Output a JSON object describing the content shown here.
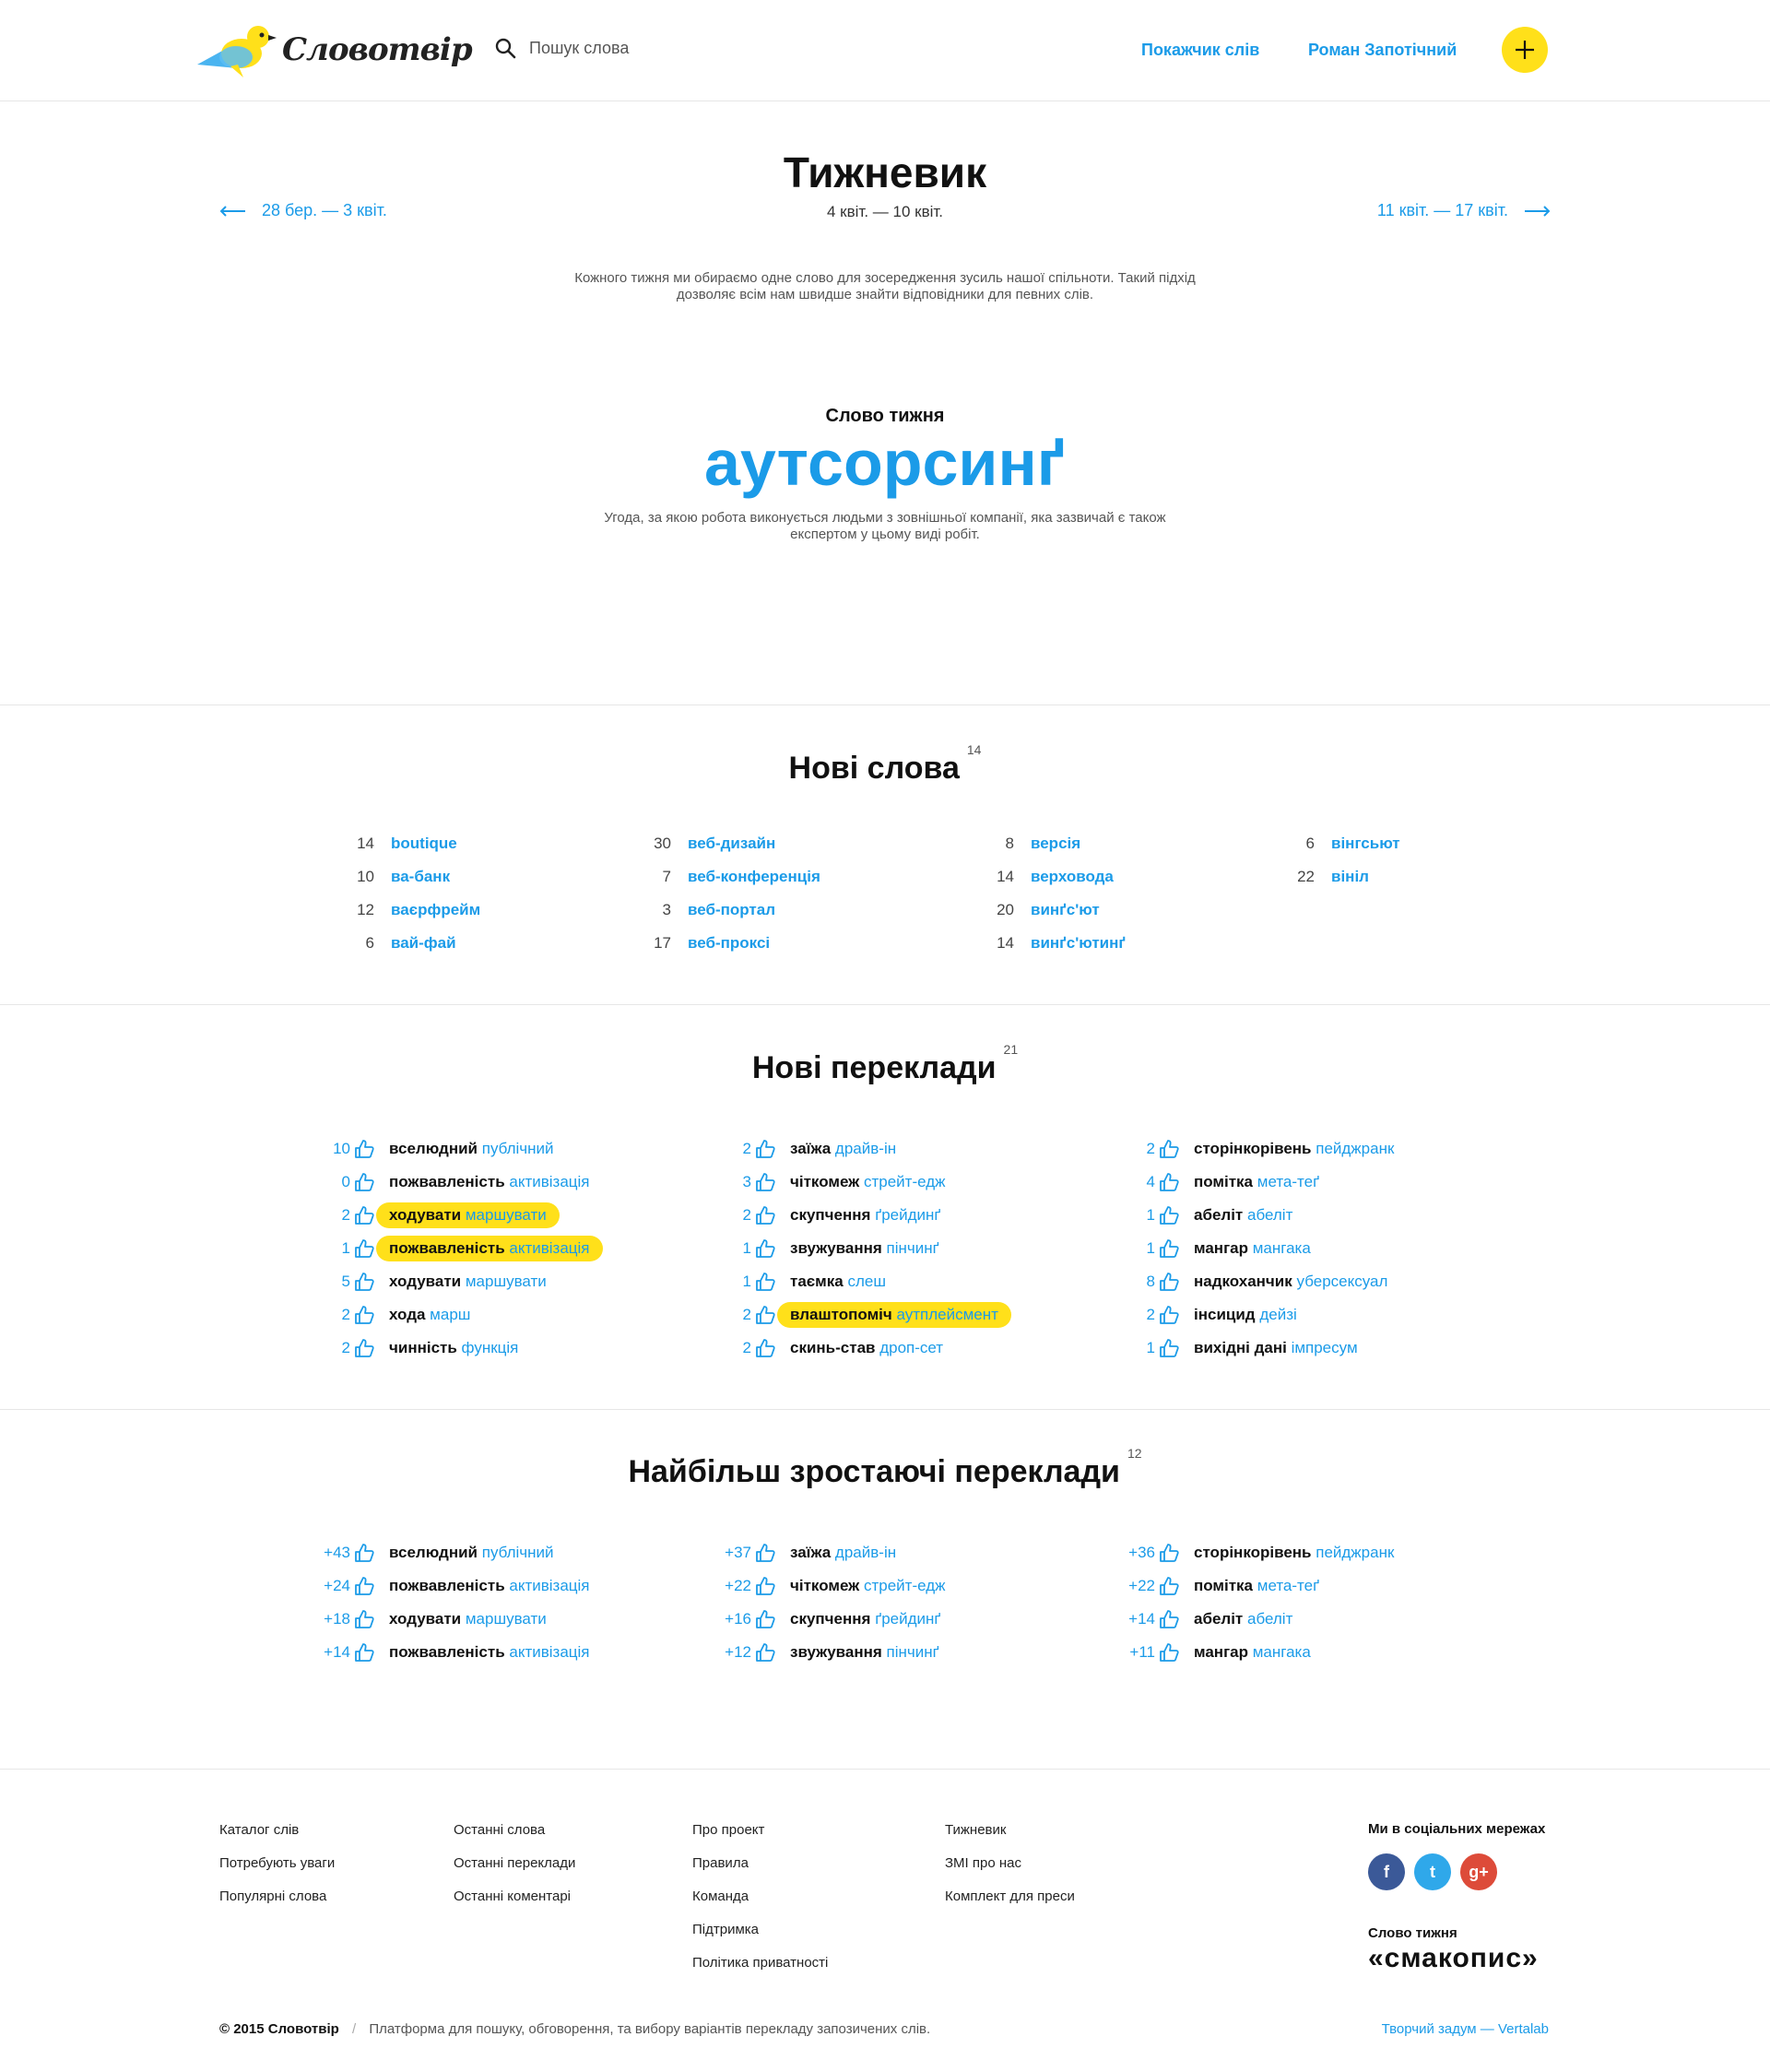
{
  "header": {
    "logo_text": "Словотвір",
    "search_placeholder": "Пошук слова",
    "nav": [
      "Покажчик слів",
      "Роман Запотічний"
    ]
  },
  "weekly": {
    "title": "Тижневик",
    "dates": "4 квіт. — 10 квіт.",
    "prev": "28 бер. — 3 квіт.",
    "next": "11 квіт. — 17 квіт.",
    "intro": "Кожного тижня ми обираємо одне слово для зосередження зусиль нашої спільноти. Такий підхід дозволяє всім нам швидше знайти відповідники для певних слів.",
    "word_label": "Слово тижня",
    "word": "аутсорсинґ",
    "definition": "Угода, за якою робота виконується людьми з зовнішньої компанії, яка зазвичай є також експертом у цьому виді робіт."
  },
  "new_words": {
    "title": "Нові слова",
    "count": "14",
    "columns": [
      [
        {
          "n": "14",
          "w": "boutique"
        },
        {
          "n": "10",
          "w": "ва-банк"
        },
        {
          "n": "12",
          "w": "ваєрфрейм"
        },
        {
          "n": "6",
          "w": "вай-фай"
        }
      ],
      [
        {
          "n": "30",
          "w": "веб-дизайн"
        },
        {
          "n": "7",
          "w": "веб-конференція"
        },
        {
          "n": "3",
          "w": "веб-портал"
        },
        {
          "n": "17",
          "w": "веб-проксі"
        }
      ],
      [
        {
          "n": "8",
          "w": "версія"
        },
        {
          "n": "14",
          "w": "верховода"
        },
        {
          "n": "20",
          "w": "винґс'ют"
        },
        {
          "n": "14",
          "w": "винґс'ютинґ"
        }
      ],
      [
        {
          "n": "6",
          "w": "вінгсьют"
        },
        {
          "n": "22",
          "w": "вініл"
        }
      ]
    ]
  },
  "new_translations": {
    "title": "Нові переклади",
    "count": "21",
    "columns": [
      [
        {
          "c": "10",
          "o": "вселюдний",
          "t": "публічний",
          "hl": false
        },
        {
          "c": "0",
          "o": "пожвавленість",
          "t": "активізація",
          "hl": false
        },
        {
          "c": "2",
          "o": "ходувати",
          "t": "маршувати",
          "hl": true
        },
        {
          "c": "1",
          "o": "пожвавленість",
          "t": "активізація",
          "hl": true
        },
        {
          "c": "5",
          "o": "ходувати",
          "t": "маршувати",
          "hl": false
        },
        {
          "c": "2",
          "o": "хода",
          "t": "марш",
          "hl": false
        },
        {
          "c": "2",
          "o": "чинність",
          "t": "функція",
          "hl": false
        }
      ],
      [
        {
          "c": "2",
          "o": "заїжа",
          "t": "драйв-ін",
          "hl": false
        },
        {
          "c": "3",
          "o": "чіткомеж",
          "t": "стрейт-едж",
          "hl": false
        },
        {
          "c": "2",
          "o": "скупчення",
          "t": "ґрейдинґ",
          "hl": false
        },
        {
          "c": "1",
          "o": "звужування",
          "t": "пінчинґ",
          "hl": false
        },
        {
          "c": "1",
          "o": "таємка",
          "t": "слеш",
          "hl": false
        },
        {
          "c": "2",
          "o": "влаштопоміч",
          "t": "аутплейсмент",
          "hl": true
        },
        {
          "c": "2",
          "o": "скинь-став",
          "t": "дроп-сет",
          "hl": false
        }
      ],
      [
        {
          "c": "2",
          "o": "сторінкорівень",
          "t": "пейджранк",
          "hl": false
        },
        {
          "c": "4",
          "o": "помітка",
          "t": "мета-теґ",
          "hl": false
        },
        {
          "c": "1",
          "o": "абеліт",
          "t": "абеліт",
          "hl": false
        },
        {
          "c": "1",
          "o": "мангар",
          "t": "мангака",
          "hl": false
        },
        {
          "c": "8",
          "o": "надкоханчик",
          "t": "уберсексуал",
          "hl": false
        },
        {
          "c": "2",
          "o": "інсицид",
          "t": "дейзі",
          "hl": false
        },
        {
          "c": "1",
          "o": "вихідні дані",
          "t": "імпресум",
          "hl": false
        }
      ]
    ]
  },
  "rising": {
    "title": "Найбільш зростаючі переклади",
    "count": "12",
    "columns": [
      [
        {
          "c": "+43",
          "o": "вселюдний",
          "t": "публічний"
        },
        {
          "c": "+24",
          "o": "пожвавленість",
          "t": "активізація"
        },
        {
          "c": "+18",
          "o": "ходувати",
          "t": "маршувати"
        },
        {
          "c": "+14",
          "o": "пожвавленість",
          "t": "активізація"
        }
      ],
      [
        {
          "c": "+37",
          "o": "заїжа",
          "t": "драйв-ін"
        },
        {
          "c": "+22",
          "o": "чіткомеж",
          "t": "стрейт-едж"
        },
        {
          "c": "+16",
          "o": "скупчення",
          "t": "ґрейдинґ"
        },
        {
          "c": "+12",
          "o": "звужування",
          "t": "пінчинґ"
        }
      ],
      [
        {
          "c": "+36",
          "o": "сторінкорівень",
          "t": "пейджранк"
        },
        {
          "c": "+22",
          "o": "помітка",
          "t": "мета-теґ"
        },
        {
          "c": "+14",
          "o": "абеліт",
          "t": "абеліт"
        },
        {
          "c": "+11",
          "o": "мангар",
          "t": "мангака"
        }
      ]
    ]
  },
  "footer": {
    "columns": [
      [
        "Каталог слів",
        "Потребують уваги",
        "Популярні слова"
      ],
      [
        "Останні слова",
        "Останні переклади",
        "Останні коментарі"
      ],
      [
        "Про проект",
        "Правила",
        "Команда",
        "Підтримка",
        "Політика приватності"
      ],
      [
        "Тижневик",
        "ЗМІ про нас",
        "Комплект для преси"
      ]
    ],
    "social_title": "Ми в соціальних мережах",
    "social": [
      {
        "icon": "facebook-icon",
        "glyph": "f",
        "color": "#3b5998"
      },
      {
        "icon": "twitter-icon",
        "glyph": "t",
        "color": "#2fa8ea"
      },
      {
        "icon": "google-plus-icon",
        "glyph": "g+",
        "color": "#dd4b39"
      }
    ],
    "wotw_label": "Слово тижня",
    "wotw": "«смакопис»",
    "copyright_brand": "© 2015 Словотвір",
    "copyright_sep": "/",
    "copyright_text": "Платформа для пошуку, обговорення, та вибору варіантів перекладу запозичених слів.",
    "credit": "Творчий задум — Vertalab"
  },
  "colors": {
    "accent": "#1b9be8",
    "highlight": "#ffe01a"
  }
}
